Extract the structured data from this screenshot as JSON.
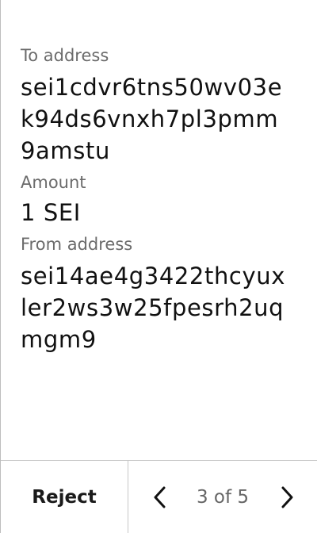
{
  "fields": {
    "to_address": {
      "label": "To address",
      "lines": [
        "sei1cdvr6tns50wv03e",
        "k94ds6vnxh7pl3pmm",
        "9amstu"
      ]
    },
    "amount": {
      "label": "Amount",
      "value": "1 SEI"
    },
    "from_address": {
      "label": "From address",
      "lines": [
        "sei14ae4g3422thcyux",
        "ler2ws3w25fpesrh2uq",
        "mgm9"
      ]
    }
  },
  "footer": {
    "reject_label": "Reject",
    "pager": {
      "text": "3 of 5",
      "current": 3,
      "total": 5
    }
  },
  "icons": {
    "prev": "chevron-left-icon",
    "next": "chevron-right-icon"
  }
}
